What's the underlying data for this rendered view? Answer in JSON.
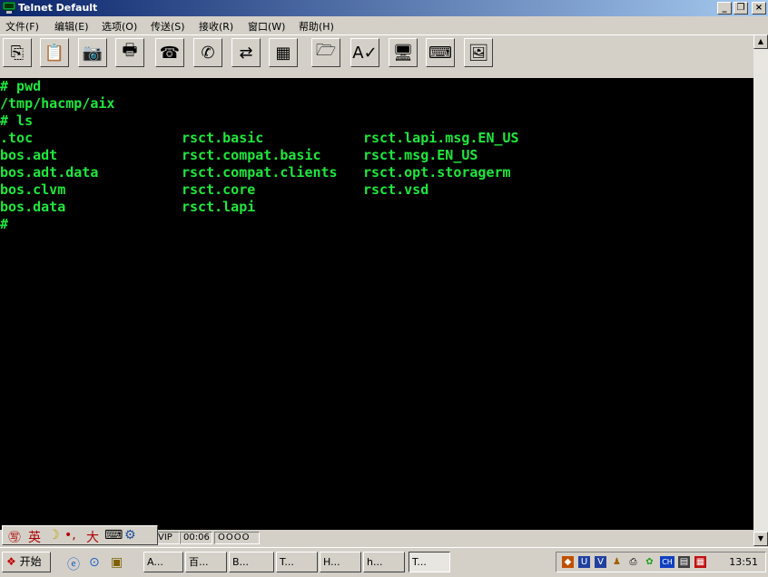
{
  "window": {
    "title": "Telnet Default",
    "minimize_symbol": "_",
    "maximize_symbol": "❐",
    "close_symbol": "×"
  },
  "menu": [
    "文件(F)",
    "编辑(E)",
    "选项(O)",
    "传送(S)",
    "接收(R)",
    "窗口(W)",
    "帮助(H)"
  ],
  "toolbar": {
    "icons": [
      "copy-icon",
      "paste-icon",
      "camera-icon",
      "print-icon",
      "dial-phone-icon",
      "hangup-phone-icon",
      "transfer-icon",
      "layout-icon",
      "send-file-icon",
      "spellcheck-icon",
      "monitor-icon",
      "keyboard-icon",
      "image-icon"
    ],
    "glyphs": [
      "⎘",
      "📋",
      "📷",
      "🖶",
      "☎",
      "✆",
      "⇄",
      "▦",
      "🗁",
      "A✓",
      "🖥",
      "⌨",
      "🖼"
    ]
  },
  "terminal": {
    "text_color": "#1ee83c",
    "lines": [
      {
        "c1": "# pwd",
        "c2": "",
        "c3": ""
      },
      {
        "c1": "/tmp/hacmp/aix",
        "c2": "",
        "c3": ""
      },
      {
        "c1": "# ls",
        "c2": "",
        "c3": ""
      },
      {
        "c1": ".toc",
        "c2": "rsct.basic",
        "c3": "rsct.lapi.msg.EN_US"
      },
      {
        "c1": "bos.adt",
        "c2": "rsct.compat.basic",
        "c3": "rsct.msg.EN_US"
      },
      {
        "c1": "bos.adt.data",
        "c2": "rsct.compat.clients",
        "c3": "rsct.opt.storagerm"
      },
      {
        "c1": "bos.clvm",
        "c2": "rsct.core",
        "c3": "rsct.vsd"
      },
      {
        "c1": "bos.data",
        "c2": "rsct.lapi",
        "c3": ""
      },
      {
        "c1": "#",
        "c2": "",
        "c3": ""
      }
    ]
  },
  "status": {
    "mode": "VIP",
    "time": "00:06",
    "indicators": "OOOO"
  },
  "ime": {
    "logo": "㊢",
    "lang": "英",
    "moon": "☽",
    "punct": "•,",
    "width": "大",
    "keyboard": "⌨",
    "extra": "⚙"
  },
  "taskbar": {
    "start_label": "开始",
    "quick_launch": [
      "ie-icon",
      "explorer-icon",
      "desktop-icon"
    ],
    "tasks": [
      "A...",
      "百...",
      "B...",
      "T...",
      "H...",
      "h...",
      "T..."
    ],
    "clock": "13:51",
    "tray_icons": [
      "network-icon",
      "shield-icon",
      "vpn-icon",
      "people-icon",
      "printer-icon",
      "connection-icon",
      "ch-language-icon",
      "ime-icon",
      "grid-icon"
    ],
    "tray_lang": "CH"
  }
}
